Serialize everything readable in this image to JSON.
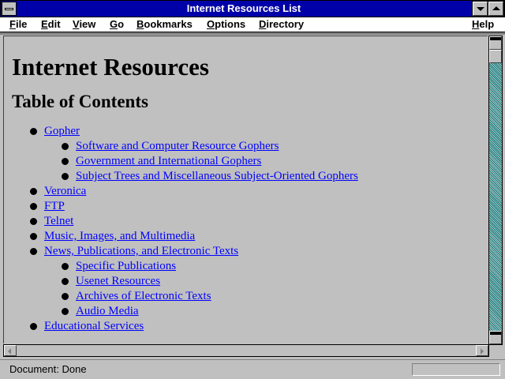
{
  "window": {
    "title": "Internet Resources List"
  },
  "menubar": {
    "items": [
      {
        "label": "File",
        "underline": "F",
        "rest": "ile"
      },
      {
        "label": "Edit",
        "underline": "E",
        "rest": "dit"
      },
      {
        "label": "View",
        "underline": "V",
        "rest": "iew"
      },
      {
        "label": "Go",
        "underline": "G",
        "rest": "o"
      },
      {
        "label": "Bookmarks",
        "underline": "B",
        "rest": "ookmarks"
      },
      {
        "label": "Options",
        "underline": "O",
        "rest": "ptions"
      },
      {
        "label": "Directory",
        "underline": "D",
        "rest": "irectory"
      },
      {
        "label": "Help",
        "underline": "H",
        "rest": "elp"
      }
    ]
  },
  "page": {
    "heading": "Internet Resources",
    "subheading": "Table of Contents",
    "toc": [
      {
        "label": "Gopher",
        "children": [
          "Software and Computer Resource Gophers",
          "Government and International Gophers",
          "Subject Trees and Miscellaneous Subject-Oriented Gophers"
        ]
      },
      {
        "label": "Veronica",
        "children": []
      },
      {
        "label": "FTP",
        "children": []
      },
      {
        "label": "Telnet",
        "children": []
      },
      {
        "label": "Music, Images, and Multimedia",
        "children": []
      },
      {
        "label": "News, Publications, and Electronic Texts",
        "children": [
          "Specific Publications",
          "Usenet Resources",
          "Archives of Electronic Texts",
          "Audio Media"
        ]
      },
      {
        "label": "Educational Services",
        "children": []
      }
    ],
    "link_color": "#0000ff"
  },
  "status": {
    "text": "Document: Done"
  },
  "colors": {
    "title_bar": "#0000a8",
    "background": "#c0c0c0",
    "scroll_track": "#008080"
  }
}
